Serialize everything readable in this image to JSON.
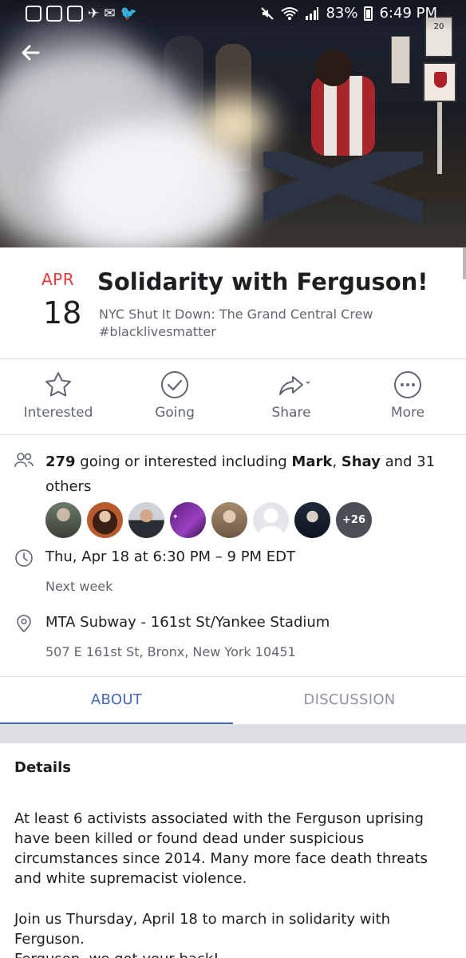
{
  "status_bar": {
    "battery": "83%",
    "time": "6:49 PM"
  },
  "hero": {
    "sign_text": "20"
  },
  "event": {
    "month": "APR",
    "day": "18",
    "title": "Solidarity with Ferguson!",
    "host": "NYC Shut It Down: The Grand Central Crew",
    "tag": "#blacklivesmatter"
  },
  "actions": [
    {
      "label": "Interested",
      "icon": "star-icon"
    },
    {
      "label": "Going",
      "icon": "check-circle-icon"
    },
    {
      "label": "Share",
      "icon": "share-arrow-icon"
    },
    {
      "label": "More",
      "icon": "more-dots-icon"
    }
  ],
  "guests": {
    "count": "279",
    "text_a": " going or interested including ",
    "name1": "Mark",
    "sep": ", ",
    "name2": "Shay",
    "text_b": " and 31 others",
    "more_badge": "+26"
  },
  "time": {
    "line": "Thu, Apr 18 at 6:30 PM – 9 PM EDT",
    "sub": "Next week"
  },
  "location": {
    "line": "MTA Subway - 161st St/Yankee Stadium",
    "sub": "507 E 161st St, Bronx, New York 10451"
  },
  "tabs": [
    {
      "label": "ABOUT",
      "active": true
    },
    {
      "label": "DISCUSSION",
      "active": false
    }
  ],
  "details": {
    "heading": "Details",
    "p1": "At least 6 activists associated with the Ferguson uprising have been killed or found dead under suspicious circumstances since 2014. Many more face death threats and white supremacist violence.",
    "p2": "Join us Thursday, April 18 to march in solidarity with Ferguson.",
    "p3": "Ferguson, we got your back!"
  },
  "colors": {
    "accent": "#4267b2",
    "date_red": "#e0393e",
    "secondary_text": "#606770"
  }
}
